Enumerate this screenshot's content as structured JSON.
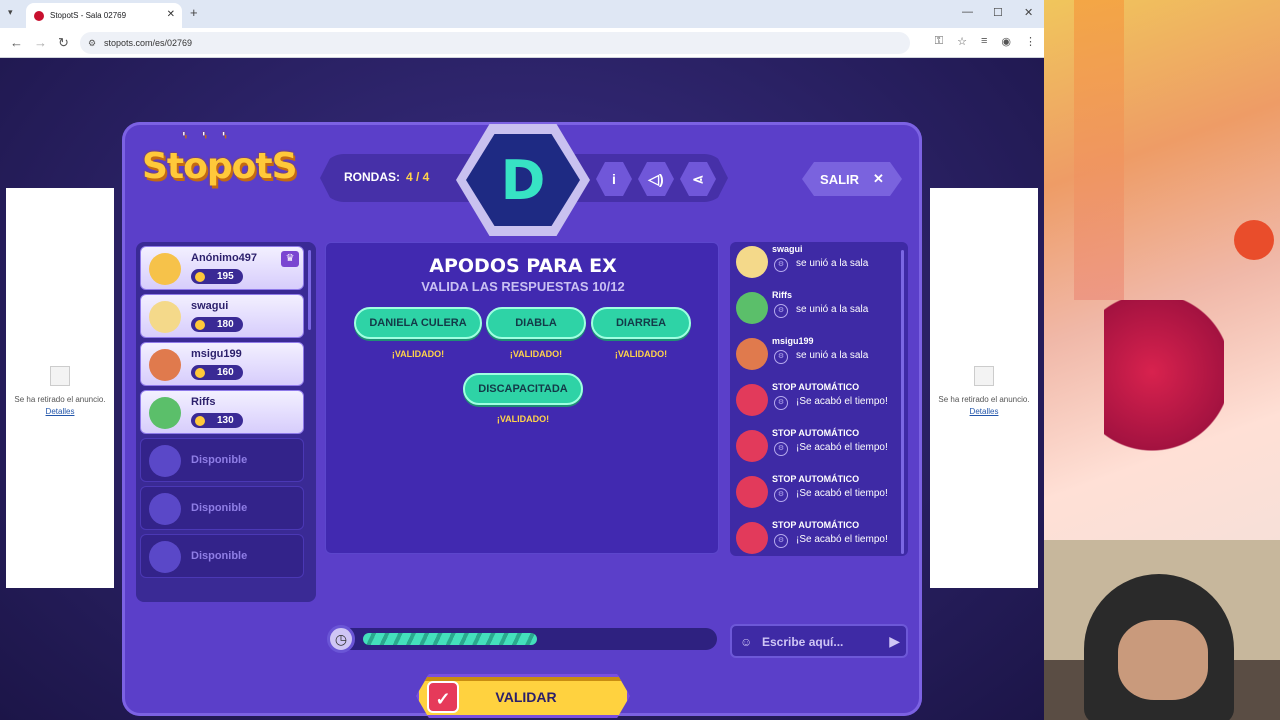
{
  "browser": {
    "tab_title": "StopotS - Sala 02769",
    "url": "stopots.com/es/02769"
  },
  "ads": {
    "text": "Se ha retirado el anuncio.",
    "link": "Detalles"
  },
  "game": {
    "logo": "StopotS",
    "rounds_label": "RONDAS:",
    "rounds_value": "4 / 4",
    "letter": "D",
    "exit_label": "SALIR",
    "category_title": "APODOS PARA EX",
    "validate_progress": "VALIDA LAS RESPUESTAS 10/12",
    "validated_label": "¡VALIDADO!",
    "answers": [
      "DANIELA CULERA",
      "DIABLA",
      "DIARREA",
      "DISCAPACITADA"
    ],
    "validate_button": "VALIDAR",
    "timer_fraction": 0.5
  },
  "players": [
    {
      "name": "Anónimo497",
      "points": "195",
      "host": true,
      "color": "#f6c24a"
    },
    {
      "name": "swagui",
      "points": "180",
      "host": false,
      "color": "#f4d98a"
    },
    {
      "name": "msigu199",
      "points": "160",
      "host": false,
      "color": "#e07a4d"
    },
    {
      "name": "Riffs",
      "points": "130",
      "host": false,
      "color": "#5bbf6a"
    },
    {
      "name": "Disponible"
    },
    {
      "name": "Disponible"
    },
    {
      "name": "Disponible"
    }
  ],
  "chat": {
    "messages": [
      {
        "who": "swagui",
        "text": "se unió a la sala",
        "color": "#f4d98a"
      },
      {
        "who": "Riffs",
        "text": "se unió a la sala",
        "color": "#5bbf6a"
      },
      {
        "who": "msigu199",
        "text": "se unió a la sala",
        "color": "#e07a4d"
      },
      {
        "who": "STOP AUTOMÁTICO",
        "text": "¡Se acabó el tiempo!",
        "color": "#e23a5b"
      },
      {
        "who": "STOP AUTOMÁTICO",
        "text": "¡Se acabó el tiempo!",
        "color": "#e23a5b"
      },
      {
        "who": "STOP AUTOMÁTICO",
        "text": "¡Se acabó el tiempo!",
        "color": "#e23a5b"
      },
      {
        "who": "STOP AUTOMÁTICO",
        "text": "¡Se acabó el tiempo!",
        "color": "#e23a5b"
      }
    ],
    "placeholder": "Escribe aquí..."
  }
}
